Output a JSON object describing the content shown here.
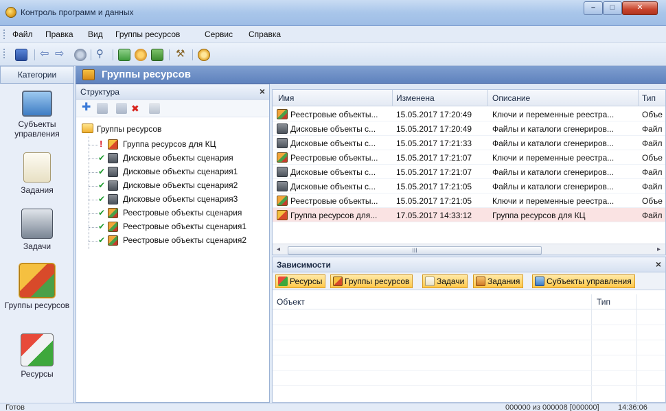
{
  "window": {
    "title": "Контроль программ и данных"
  },
  "menu": [
    {
      "label": "Файл"
    },
    {
      "label": "Правка"
    },
    {
      "label": "Вид"
    },
    {
      "label": "Группы ресурсов"
    },
    {
      "label": "Сервис"
    },
    {
      "label": "Справка"
    }
  ],
  "toolbar_icons": [
    "save-icon",
    "back-icon",
    "forward-icon",
    "gear-icon",
    "search-icon",
    "refresh-icon",
    "settings-icon",
    "calculator-icon",
    "tools-icon",
    "help-icon"
  ],
  "categories": {
    "header": "Категории",
    "items": [
      {
        "label": "Субъекты управления",
        "icon": "users-icon"
      },
      {
        "label": "Задания",
        "icon": "tasks-icon"
      },
      {
        "label": "Задачи",
        "icon": "printer-icon"
      },
      {
        "label": "Группы ресурсов",
        "icon": "resource-groups-icon",
        "selected": true
      },
      {
        "label": "Ресурсы",
        "icon": "resources-icon"
      }
    ]
  },
  "main_header": {
    "title": "Группы ресурсов"
  },
  "structure": {
    "title": "Структура",
    "close": "×",
    "root": "Группы ресурсов",
    "items": [
      {
        "label": "Группа ресурсов для КЦ",
        "status": "!",
        "type": "group"
      },
      {
        "label": "Дисковые объекты сценария",
        "status": "✔",
        "type": "disk"
      },
      {
        "label": "Дисковые объекты сценария1",
        "status": "✔",
        "type": "disk"
      },
      {
        "label": "Дисковые объекты сценария2",
        "status": "✔",
        "type": "disk"
      },
      {
        "label": "Дисковые объекты сценария3",
        "status": "✔",
        "type": "disk"
      },
      {
        "label": "Реестровые объекты сценария",
        "status": "✔",
        "type": "reg"
      },
      {
        "label": "Реестровые объекты сценария1",
        "status": "✔",
        "type": "reg"
      },
      {
        "label": "Реестровые объекты сценария2",
        "status": "✔",
        "type": "reg"
      }
    ]
  },
  "list": {
    "columns": [
      "Имя",
      "Изменена",
      "Описание",
      "Тип"
    ],
    "rows": [
      {
        "name": "Реестровые объекты...",
        "modified": "15.05.2017 17:20:49",
        "desc": "Ключи и переменные реестра...",
        "type": "Объе",
        "icon": "reg"
      },
      {
        "name": "Дисковые объекты с...",
        "modified": "15.05.2017 17:20:49",
        "desc": "Файлы и каталоги сгенериров...",
        "type": "Файл",
        "icon": "disk"
      },
      {
        "name": "Дисковые объекты с...",
        "modified": "15.05.2017 17:21:33",
        "desc": "Файлы и каталоги сгенериров...",
        "type": "Файл",
        "icon": "disk"
      },
      {
        "name": "Реестровые объекты...",
        "modified": "15.05.2017 17:21:07",
        "desc": "Ключи и переменные реестра...",
        "type": "Объе",
        "icon": "reg"
      },
      {
        "name": "Дисковые объекты с...",
        "modified": "15.05.2017 17:21:07",
        "desc": "Файлы и каталоги сгенериров...",
        "type": "Файл",
        "icon": "disk"
      },
      {
        "name": "Дисковые объекты с...",
        "modified": "15.05.2017 17:21:05",
        "desc": "Файлы и каталоги сгенериров...",
        "type": "Файл",
        "icon": "disk"
      },
      {
        "name": "Реестровые объекты...",
        "modified": "15.05.2017 17:21:05",
        "desc": "Ключи и переменные реестра...",
        "type": "Объе",
        "icon": "reg"
      },
      {
        "name": "Группа ресурсов для...",
        "modified": "17.05.2017 14:33:12",
        "desc": "Группа ресурсов для КЦ",
        "type": "Файл",
        "icon": "group",
        "highlight": true
      }
    ],
    "scroll_label": "III"
  },
  "dependencies": {
    "title": "Зависимости",
    "close": "×",
    "tabs": [
      "Ресурсы",
      "Группы ресурсов",
      "Задачи",
      "Задания",
      "Субъекты управления"
    ],
    "columns": [
      "Объект",
      "Тип"
    ]
  },
  "status": {
    "left": "Готов",
    "count": "000000 из 000008 [000000]",
    "time": "14:36:06"
  }
}
